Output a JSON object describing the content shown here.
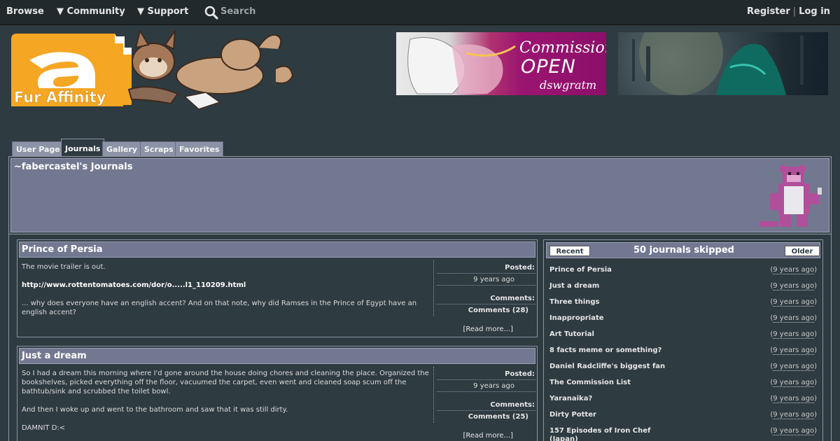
{
  "nav": {
    "browse": "Browse",
    "community": "▼ Community",
    "support": "▼ Support",
    "search": "Search",
    "register": "Register",
    "separator": "|",
    "login": "Log in"
  },
  "logo": {
    "text": "Fur Affinity"
  },
  "banners": {
    "banner1": {
      "line1": "Commissions",
      "line2": "OPEN",
      "line3": "dswgratm"
    }
  },
  "tabs": [
    "User Page",
    "Journals",
    "Gallery",
    "Scraps",
    "Favorites"
  ],
  "active_tab": "Journals",
  "page": {
    "title": "~fabercastel's Journals"
  },
  "journals": [
    {
      "title": "Prince of Persia",
      "paragraphs": [
        "The movie trailer is out.",
        "http://www.rottentomatoes.com/dor/o.....l1_110209.html",
        "... why does everyone have an english accent? And on that note, why did Ramses in the Prince of Egypt have an english accent?"
      ],
      "posted_label": "Posted:",
      "posted_value": "9 years ago",
      "comments_label": "Comments:",
      "comments_value": "Comments (28)",
      "read_more": "[Read more...]"
    },
    {
      "title": "Just a dream",
      "paragraphs": [
        "So I had a dream this morning where I'd gone around the house doing chores and cleaning the place. Organized the bookshelves, picked everything off the floor, vacuumed the carpet, even went and cleaned soap scum off the bathtub/sink and scrubbed the toilet bowl.",
        "And then I woke up and went to the bathroom and saw that it was still dirty.",
        "DAMNIT D:<"
      ],
      "posted_label": "Posted:",
      "posted_value": "9 years ago",
      "comments_label": "Comments:",
      "comments_value": "Comments (25)",
      "read_more": "[Read more...]"
    }
  ],
  "sidebar": {
    "recent": "Recent",
    "skipped": "50 journals skipped",
    "older": "Older",
    "items": [
      {
        "name": "Prince of Persia",
        "ago": "9 years ago"
      },
      {
        "name": "Just a dream",
        "ago": "9 years ago"
      },
      {
        "name": "Three things",
        "ago": "9 years ago"
      },
      {
        "name": "Inappropriate",
        "ago": "9 years ago"
      },
      {
        "name": "Art Tutorial",
        "ago": "9 years ago"
      },
      {
        "name": "8 facts meme or something?",
        "ago": "9 years ago"
      },
      {
        "name": "Daniel Radcliffe's biggest fan",
        "ago": "9 years ago"
      },
      {
        "name": "The Commission List",
        "ago": "9 years ago"
      },
      {
        "name": "Yaranaika?",
        "ago": "9 years ago"
      },
      {
        "name": "Dirty Potter",
        "ago": "9 years ago"
      },
      {
        "name": "157 Episodes of Iron Chef (Japan)",
        "ago": "9 years ago"
      }
    ]
  },
  "colors": {
    "bg": "#2e3b41",
    "panel": "#737891",
    "logo_orange": "#f5a623"
  }
}
